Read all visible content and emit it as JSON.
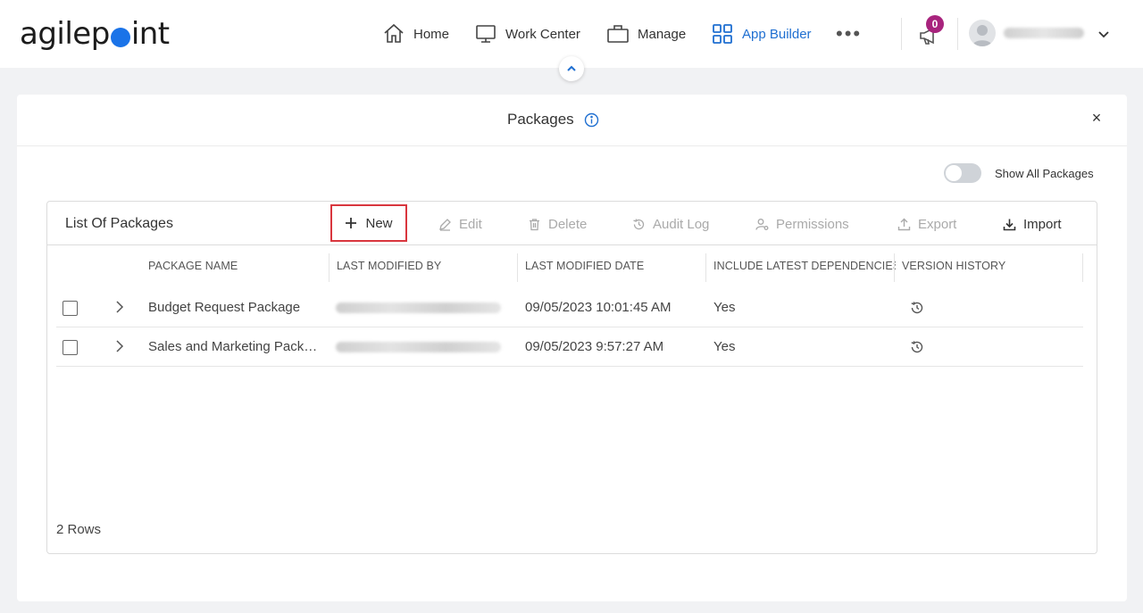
{
  "nav": {
    "home": "Home",
    "work_center": "Work Center",
    "manage": "Manage",
    "app_builder": "App Builder"
  },
  "notifications": {
    "count": "0"
  },
  "panel": {
    "title": "Packages",
    "show_all_label": "Show All Packages"
  },
  "grid": {
    "title": "List Of Packages",
    "toolbar": {
      "new": "New",
      "edit": "Edit",
      "delete": "Delete",
      "audit_log": "Audit Log",
      "permissions": "Permissions",
      "export": "Export",
      "import": "Import"
    },
    "columns": [
      "Package Name",
      "Last Modified By",
      "Last Modified Date",
      "Include Latest Dependencies",
      "Version History"
    ],
    "rows": [
      {
        "name": "Budget Request Package",
        "date": "09/05/2023 10:01:45 AM",
        "deps": "Yes"
      },
      {
        "name": "Sales and Marketing Packa...",
        "date": "09/05/2023 9:57:27 AM",
        "deps": "Yes"
      }
    ],
    "row_count": "2 Rows"
  },
  "colors": {
    "accent": "#1f6fd1",
    "badge": "#a8237d",
    "highlight": "#d9363e"
  }
}
